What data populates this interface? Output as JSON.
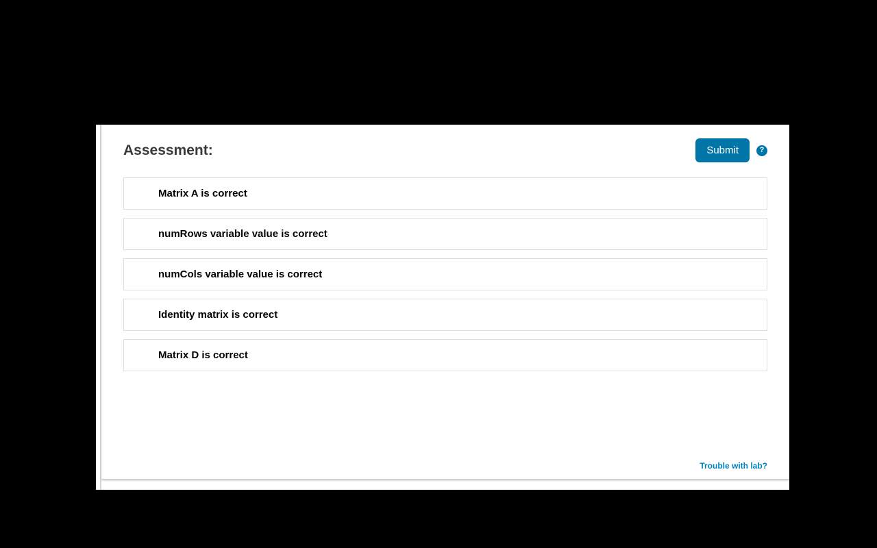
{
  "title": "Assessment:",
  "submit_label": "Submit",
  "help_glyph": "?",
  "items": [
    {
      "label": "Matrix A is correct"
    },
    {
      "label": "numRows variable value is correct"
    },
    {
      "label": "numCols variable value is correct"
    },
    {
      "label": "Identity matrix is correct"
    },
    {
      "label": "Matrix D is correct"
    }
  ],
  "trouble_link": "Trouble with lab?",
  "colors": {
    "accent": "#0076a8",
    "link": "#0083bf"
  }
}
